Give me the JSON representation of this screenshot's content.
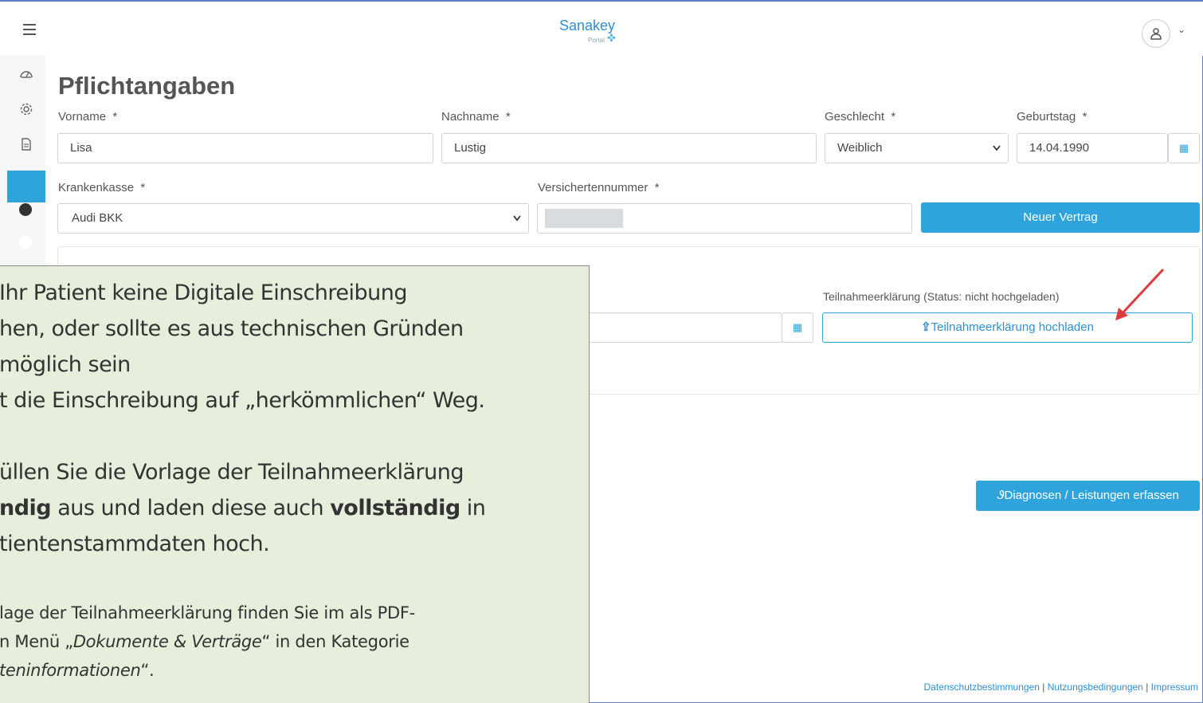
{
  "header": {
    "logo_text": "Sanakey",
    "logo_sub": "Portal",
    "menu_icon": "hamburger-icon",
    "user_icon": "user-icon",
    "chevron": "⌄"
  },
  "sidebar": {
    "items": [
      {
        "icon": "dashboard-icon"
      },
      {
        "icon": "gear-icon"
      },
      {
        "icon": "document-icon"
      },
      {
        "icon": "dot-icon"
      },
      {
        "icon": "dot-icon-active"
      }
    ]
  },
  "main": {
    "title": "Pflichtangaben",
    "fields": {
      "vorname": {
        "label": "Vorname",
        "required": "*",
        "value": "Lisa"
      },
      "nachname": {
        "label": "Nachname",
        "required": "*",
        "value": "Lustig"
      },
      "geschlecht": {
        "label": "Geschlecht",
        "required": "*",
        "value": "Weiblich"
      },
      "geburtstag": {
        "label": "Geburtstag",
        "required": "*",
        "value": "14.04.1990"
      },
      "krankenkasse": {
        "label": "Krankenkasse",
        "required": "*",
        "value": "Audi BKK"
      },
      "versichertennummer": {
        "label": "Versichertennummer",
        "required": "*",
        "value": ""
      }
    },
    "new_contract_button": "Neuer Vertrag",
    "card": {
      "upload_label": "Teilnahmeerklärung (Status: nicht hochgeladen)",
      "upload_button": "Teilnahmeerklärung hochladen"
    },
    "diagnose_button": "Diagnosen / Leistungen erfassen"
  },
  "footer": {
    "links": [
      "Datenschutzbestimmungen",
      "Nutzungsbedingungen",
      "Impressum"
    ],
    "separator": "|"
  },
  "annotation": {
    "line1": "Ihr Patient keine Digitale Einschreibung",
    "line2": "hen, oder sollte es aus technischen Gründen",
    "line3": "möglich sein",
    "line4": "t die Einschreibung auf „herkömmlichen“ Weg.",
    "line5": "üllen Sie die Vorlage der Teilnahmeerklärung",
    "line6_a": "ndig",
    "line6_b": " aus und laden diese auch ",
    "line6_c": "vollständig",
    "line6_d": " in",
    "line7": "tientenstammdaten hoch.",
    "line8": "lage der Teilnahmeerklärung finden Sie im als PDF-",
    "line9_a": "n Menü „",
    "line9_b": "Dokumente & Verträge",
    "line9_c": "“ in den Kategorie",
    "line10_a": "teninformationen",
    "line10_b": "“."
  },
  "colors": {
    "accent": "#2fa3dc",
    "note_bg": "#e6efdc",
    "arrow": "#e03a3a"
  }
}
